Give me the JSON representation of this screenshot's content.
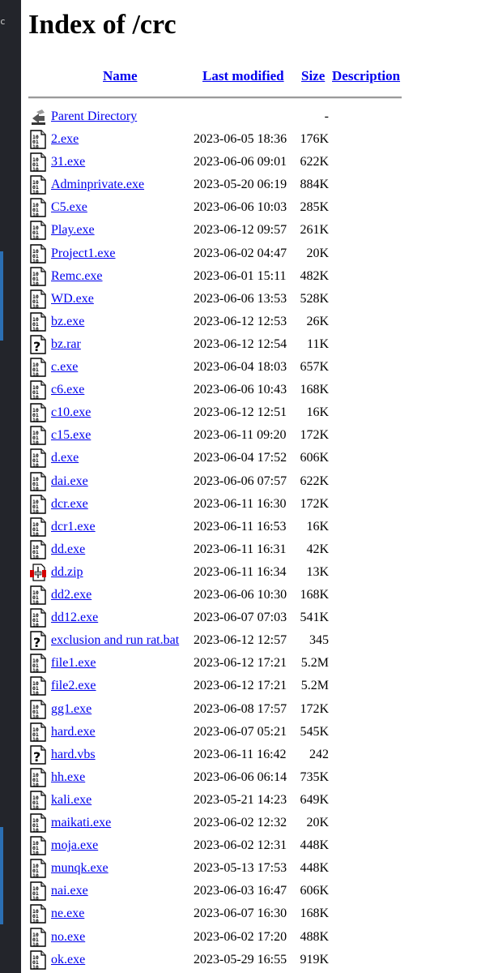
{
  "editor_edge": {
    "glyph": "c"
  },
  "page_title": "Index of /crc",
  "columns": {
    "name": "Name",
    "last_modified": "Last modified",
    "size": "Size",
    "description": "Description"
  },
  "parent": {
    "name": "Parent Directory",
    "size": "-",
    "icon": "back-arrow-icon"
  },
  "files": [
    {
      "name": "2.exe",
      "date": "2023-06-05 18:36",
      "size": "176K",
      "icon": "binary-icon"
    },
    {
      "name": "31.exe",
      "date": "2023-06-06 09:01",
      "size": "622K",
      "icon": "binary-icon"
    },
    {
      "name": "Adminprivate.exe",
      "date": "2023-05-20 06:19",
      "size": "884K",
      "icon": "binary-icon"
    },
    {
      "name": "C5.exe",
      "date": "2023-06-06 10:03",
      "size": "285K",
      "icon": "binary-icon"
    },
    {
      "name": "Play.exe",
      "date": "2023-06-12 09:57",
      "size": "261K",
      "icon": "binary-icon"
    },
    {
      "name": "Project1.exe",
      "date": "2023-06-02 04:47",
      "size": "20K",
      "icon": "binary-icon"
    },
    {
      "name": "Remc.exe",
      "date": "2023-06-01 15:11",
      "size": "482K",
      "icon": "binary-icon"
    },
    {
      "name": "WD.exe",
      "date": "2023-06-06 13:53",
      "size": "528K",
      "icon": "binary-icon"
    },
    {
      "name": "bz.exe",
      "date": "2023-06-12 12:53",
      "size": "26K",
      "icon": "binary-icon"
    },
    {
      "name": "bz.rar",
      "date": "2023-06-12 12:54",
      "size": "11K",
      "icon": "unknown-icon"
    },
    {
      "name": "c.exe",
      "date": "2023-06-04 18:03",
      "size": "657K",
      "icon": "binary-icon"
    },
    {
      "name": "c6.exe",
      "date": "2023-06-06 10:43",
      "size": "168K",
      "icon": "binary-icon"
    },
    {
      "name": "c10.exe",
      "date": "2023-06-12 12:51",
      "size": "16K",
      "icon": "binary-icon"
    },
    {
      "name": "c15.exe",
      "date": "2023-06-11 09:20",
      "size": "172K",
      "icon": "binary-icon"
    },
    {
      "name": "d.exe",
      "date": "2023-06-04 17:52",
      "size": "606K",
      "icon": "binary-icon"
    },
    {
      "name": "dai.exe",
      "date": "2023-06-06 07:57",
      "size": "622K",
      "icon": "binary-icon"
    },
    {
      "name": "dcr.exe",
      "date": "2023-06-11 16:30",
      "size": "172K",
      "icon": "binary-icon"
    },
    {
      "name": "dcr1.exe",
      "date": "2023-06-11 16:53",
      "size": "16K",
      "icon": "binary-icon"
    },
    {
      "name": "dd.exe",
      "date": "2023-06-11 16:31",
      "size": "42K",
      "icon": "binary-icon"
    },
    {
      "name": "dd.zip",
      "date": "2023-06-11 16:34",
      "size": "13K",
      "icon": "compressed-icon"
    },
    {
      "name": "dd2.exe",
      "date": "2023-06-06 10:30",
      "size": "168K",
      "icon": "binary-icon"
    },
    {
      "name": "dd12.exe",
      "date": "2023-06-07 07:03",
      "size": "541K",
      "icon": "binary-icon"
    },
    {
      "name": "exclusion and run rat.bat",
      "date": "2023-06-12 12:57",
      "size": "345",
      "icon": "unknown-icon"
    },
    {
      "name": "file1.exe",
      "date": "2023-06-12 17:21",
      "size": "5.2M",
      "icon": "binary-icon"
    },
    {
      "name": "file2.exe",
      "date": "2023-06-12 17:21",
      "size": "5.2M",
      "icon": "binary-icon"
    },
    {
      "name": "gg1.exe",
      "date": "2023-06-08 17:57",
      "size": "172K",
      "icon": "binary-icon"
    },
    {
      "name": "hard.exe",
      "date": "2023-06-07 05:21",
      "size": "545K",
      "icon": "binary-icon"
    },
    {
      "name": "hard.vbs",
      "date": "2023-06-11 16:42",
      "size": "242",
      "icon": "unknown-icon"
    },
    {
      "name": "hh.exe",
      "date": "2023-06-06 06:14",
      "size": "735K",
      "icon": "binary-icon"
    },
    {
      "name": "kali.exe",
      "date": "2023-05-21 14:23",
      "size": "649K",
      "icon": "binary-icon"
    },
    {
      "name": "maikati.exe",
      "date": "2023-06-02 12:32",
      "size": "20K",
      "icon": "binary-icon"
    },
    {
      "name": "moja.exe",
      "date": "2023-06-02 12:31",
      "size": "448K",
      "icon": "binary-icon"
    },
    {
      "name": "munqk.exe",
      "date": "2023-05-13 17:53",
      "size": "448K",
      "icon": "binary-icon"
    },
    {
      "name": "nai.exe",
      "date": "2023-06-03 16:47",
      "size": "606K",
      "icon": "binary-icon"
    },
    {
      "name": "ne.exe",
      "date": "2023-06-07 16:30",
      "size": "168K",
      "icon": "binary-icon"
    },
    {
      "name": "no.exe",
      "date": "2023-06-02 17:20",
      "size": "488K",
      "icon": "binary-icon"
    },
    {
      "name": "ok.exe",
      "date": "2023-05-29 16:55",
      "size": "919K",
      "icon": "binary-icon"
    }
  ]
}
